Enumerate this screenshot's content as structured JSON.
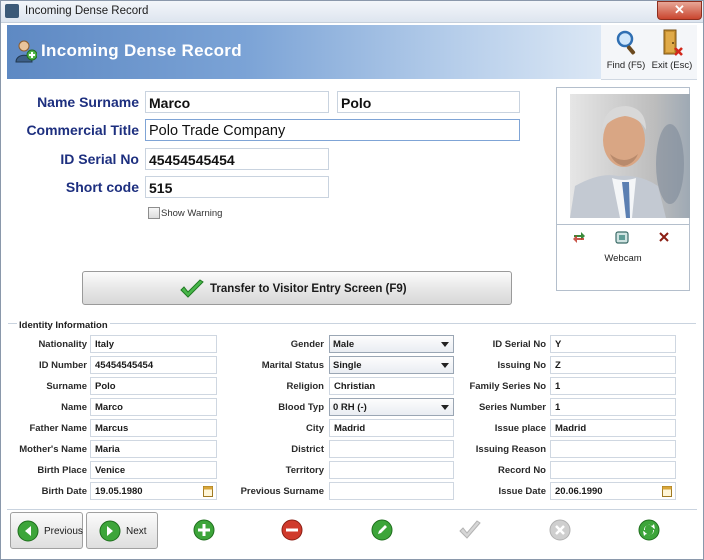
{
  "window": {
    "title": "Incoming Dense Record",
    "close_symbol": "✕"
  },
  "header": {
    "title": "Incoming Dense Record"
  },
  "toolbar": {
    "find_label": "Find (F5)",
    "exit_label": "Exit (Esc)"
  },
  "form": {
    "name_surname_label": "Name Surname",
    "first_name": "Marco",
    "surname": "Polo",
    "commercial_title_label": "Commercial Title",
    "commercial_title": "Polo Trade Company",
    "id_serial_label": "ID Serial No",
    "id_serial": "45454545454",
    "short_code_label": "Short code",
    "short_code": "515",
    "show_warning_label": "Show Warning",
    "show_warning_checked": false
  },
  "photo": {
    "webcam_label": "Webcam"
  },
  "transfer_button": {
    "label": "Transfer to Visitor Entry Screen (F9)"
  },
  "identity": {
    "section_title": "Identity Information",
    "col1": [
      {
        "label": "Nationality",
        "value": "Italy"
      },
      {
        "label": "ID Number",
        "value": "45454545454"
      },
      {
        "label": "Surname",
        "value": "Polo"
      },
      {
        "label": "Name",
        "value": "Marco"
      },
      {
        "label": "Father Name",
        "value": "Marcus"
      },
      {
        "label": "Mother's Name",
        "value": "Maria"
      },
      {
        "label": "Birth Place",
        "value": "Venice"
      },
      {
        "label": "Birth Date",
        "value": "19.05.1980"
      }
    ],
    "col2": [
      {
        "label": "Gender",
        "value": "Male"
      },
      {
        "label": "Marital Status",
        "value": "Single"
      },
      {
        "label": "Religion",
        "value": "Christian"
      },
      {
        "label": "Blood Typ",
        "value": "0 RH (-)"
      },
      {
        "label": "City",
        "value": "Madrid"
      },
      {
        "label": "District",
        "value": ""
      },
      {
        "label": "Territory",
        "value": ""
      },
      {
        "label": "Previous Surname",
        "value": ""
      }
    ],
    "col3": [
      {
        "label": "ID Serial No",
        "value": "Y"
      },
      {
        "label": "Issuing No",
        "value": "Z"
      },
      {
        "label": "Family Series No",
        "value": "1"
      },
      {
        "label": "Series Number",
        "value": "1"
      },
      {
        "label": "Issue place",
        "value": "Madrid"
      },
      {
        "label": "Issuing Reason",
        "value": ""
      },
      {
        "label": "Record No",
        "value": ""
      },
      {
        "label": "Issue Date",
        "value": "20.06.1990"
      }
    ]
  },
  "nav": {
    "previous_label": "Previous",
    "next_label": "Next"
  },
  "colors": {
    "header_blue": "#5e89c3",
    "label_navy": "#1d2f7f",
    "action_green": "#3da53a",
    "action_red": "#d03a2c"
  }
}
